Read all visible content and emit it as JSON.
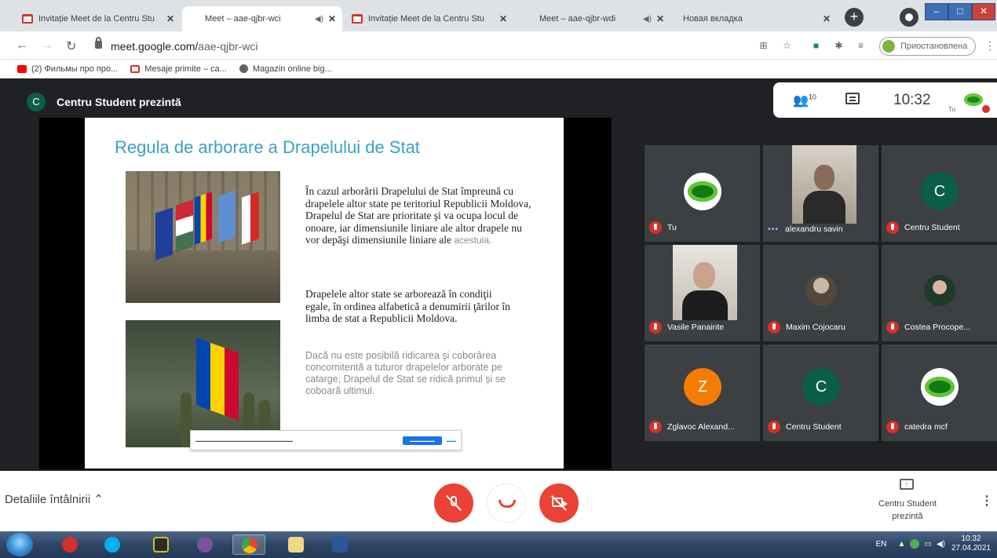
{
  "browser": {
    "tabs": [
      {
        "title": "Invitație Meet de la Centru Stu",
        "icon": "gmail-icon",
        "active": false
      },
      {
        "title": "Meet – aae-qjbr-wci",
        "icon": "meet-icon",
        "active": true
      },
      {
        "title": "Invitație Meet de la Centru Stu",
        "icon": "gmail-icon",
        "active": false
      },
      {
        "title": "Meet – aae-qjbr-wdi",
        "icon": "meet-icon",
        "active": false
      },
      {
        "title": "Новая вкладка",
        "icon": "",
        "active": false
      }
    ],
    "url_host": "meet.google.com/",
    "url_path": "aae-qjbr-wci",
    "profile_status": "Приостановлена",
    "bookmarks": [
      {
        "label": "(2) Фильмы про про...",
        "icon": "youtube-icon"
      },
      {
        "label": "Mesaje primite – ca...",
        "icon": "gmail-icon"
      },
      {
        "label": "Magazin online big...",
        "icon": "globe-icon"
      }
    ]
  },
  "meet": {
    "presenter_initial": "C",
    "presenter_name": "Centru Student prezintă",
    "participant_count": "10",
    "clock": "10:32",
    "self_label": "Tu",
    "slide": {
      "title": "Regula de arborare a Drapelului de Stat",
      "paragraph1": "În cazul arborării Drapelului de Stat împreună cu drapelele altor state pe teritoriul Republicii Moldova, Drapelul de Stat are prioritate şi va ocupa locul de onoare, iar dimensiunile liniare ale altor drapele nu vor depăşi dimensiunile liniare ale",
      "paragraph1_tail": "acestuia.",
      "paragraph2": "Drapelele altor state se arborează în condiţii egale, în ordinea alfabetică a denumirii ţărilor în limba de stat a Republicii Moldova.",
      "paragraph3": "Dacă nu este posibilă ridicarea şi coborârea concomitentă a tuturor drapelelor arborate pe catarge, Drapelul de Stat se ridică primul şi se coboară ultimul."
    },
    "participants": [
      {
        "name": "Tu",
        "type": "eye-avatar"
      },
      {
        "name": "alexandru savin",
        "type": "video"
      },
      {
        "name": "Centru Student",
        "type": "initial",
        "initial": "C",
        "color": "#0b5e4a"
      },
      {
        "name": "Vasile Panainte",
        "type": "video"
      },
      {
        "name": "Maxim Cojocaru",
        "type": "photo"
      },
      {
        "name": "Costea Procope...",
        "type": "photo"
      },
      {
        "name": "Zglavoc Alexand...",
        "type": "initial",
        "initial": "Z",
        "color": "#f57c00"
      },
      {
        "name": "Centru Student",
        "type": "initial",
        "initial": "C",
        "color": "#0b5e4a"
      },
      {
        "name": "catedra mcf",
        "type": "eye-avatar"
      }
    ],
    "details_label": "Detaliile întâlnirii",
    "present_status": "Centru Student prezintă"
  },
  "taskbar": {
    "language": "EN",
    "time": "10:32",
    "date": "27.04.2021"
  }
}
